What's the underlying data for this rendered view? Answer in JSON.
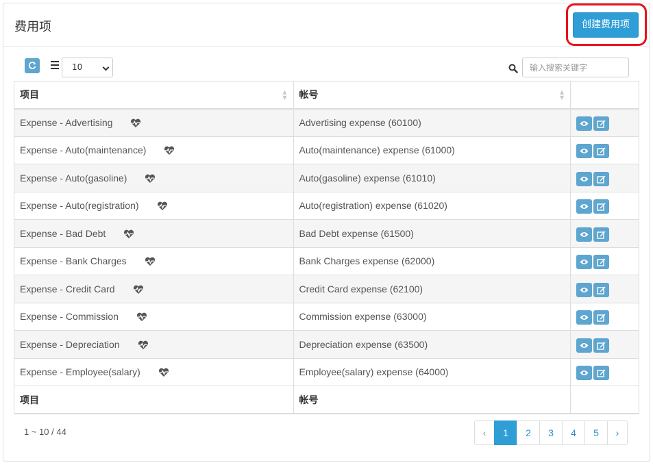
{
  "header": {
    "title": "费用项",
    "create_button": "创建费用项"
  },
  "toolbar": {
    "page_size": "10",
    "search_placeholder": "输入搜索关键字"
  },
  "table": {
    "columns": [
      "项目",
      "帐号"
    ],
    "rows": [
      {
        "item": "Expense - Advertising",
        "account": "Advertising expense (60100)"
      },
      {
        "item": "Expense - Auto(maintenance)",
        "account": "Auto(maintenance) expense (61000)"
      },
      {
        "item": "Expense - Auto(gasoline)",
        "account": "Auto(gasoline) expense (61010)"
      },
      {
        "item": "Expense - Auto(registration)",
        "account": "Auto(registration) expense (61020)"
      },
      {
        "item": "Expense - Bad Debt",
        "account": "Bad Debt expense (61500)"
      },
      {
        "item": "Expense - Bank Charges",
        "account": "Bank Charges expense (62000)"
      },
      {
        "item": "Expense - Credit Card",
        "account": "Credit Card expense (62100)"
      },
      {
        "item": "Expense - Commission",
        "account": "Commission expense (63000)"
      },
      {
        "item": "Expense - Depreciation",
        "account": "Depreciation expense (63500)"
      },
      {
        "item": "Expense - Employee(salary)",
        "account": "Employee(salary) expense (64000)"
      }
    ],
    "footer": [
      "项目",
      "帐号"
    ]
  },
  "pagination": {
    "summary": "1 ~ 10 / 44",
    "prev": "‹",
    "pages": [
      "1",
      "2",
      "3",
      "4",
      "5"
    ],
    "next": "›",
    "active": "1"
  },
  "colors": {
    "primary": "#2f9ed6",
    "action": "#5ea5cf",
    "highlight": "#e8121b"
  },
  "icons": {
    "row_status": "heartbeat-icon",
    "view": "eye-icon",
    "edit": "edit-icon",
    "refresh": "refresh-icon",
    "list": "list-icon",
    "search": "search-icon"
  }
}
